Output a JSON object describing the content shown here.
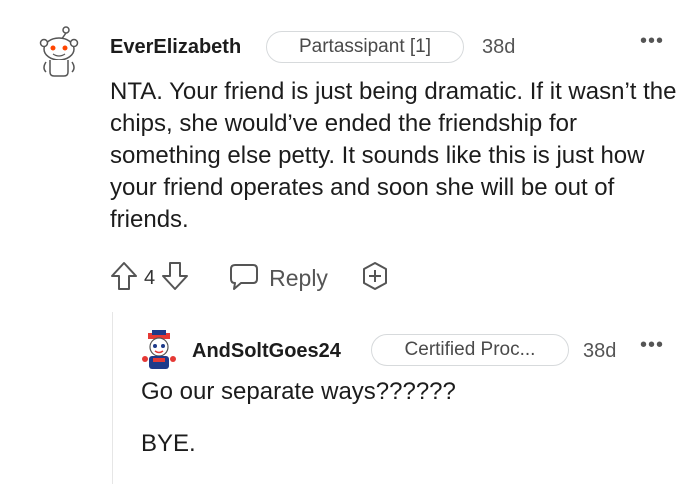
{
  "comment": {
    "username": "EverElizabeth",
    "flair": "Partassipant [1]",
    "time": "38d",
    "more": "•••",
    "body": "NTA. Your friend is just being dramatic. If it wasn’t the chips, she would’ve ended the friendship for something else petty. It sounds like this is just how your friend operates and soon she will be out of friends.",
    "votes": "4",
    "reply_label": "Reply"
  },
  "reply": {
    "username": "AndSoltGoes24",
    "flair": "Certified Proc...",
    "time": "38d",
    "more": "•••",
    "line1": "Go our separate ways??????",
    "line2": "BYE."
  },
  "colors": {
    "accent_red": "#ff4500",
    "text": "#1c1c1c",
    "muted": "#555555",
    "border": "#d7dadc"
  }
}
